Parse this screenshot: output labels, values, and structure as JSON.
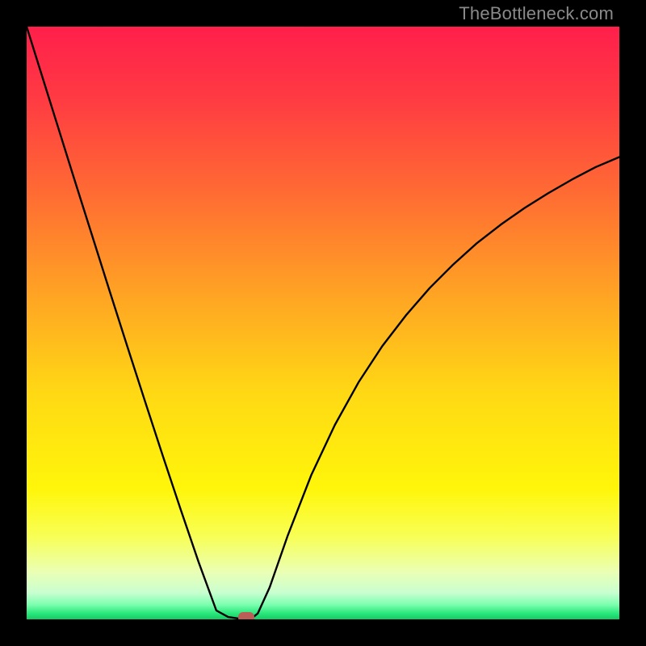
{
  "watermark": {
    "text": "TheBottleneck.com"
  },
  "colors": {
    "frame": "#000000",
    "curve": "#000000",
    "marker": "#bb5e57",
    "gradient_stops": [
      {
        "pct": 0.0,
        "color": "#ff1f4b"
      },
      {
        "pct": 0.12,
        "color": "#ff3a43"
      },
      {
        "pct": 0.28,
        "color": "#ff6b33"
      },
      {
        "pct": 0.45,
        "color": "#ffa324"
      },
      {
        "pct": 0.62,
        "color": "#ffd914"
      },
      {
        "pct": 0.78,
        "color": "#fff60a"
      },
      {
        "pct": 0.86,
        "color": "#f8ff55"
      },
      {
        "pct": 0.92,
        "color": "#eaffb4"
      },
      {
        "pct": 0.955,
        "color": "#c9ffd0"
      },
      {
        "pct": 0.975,
        "color": "#7dffb0"
      },
      {
        "pct": 0.99,
        "color": "#28e87a"
      },
      {
        "pct": 1.0,
        "color": "#17c964"
      }
    ]
  },
  "chart_data": {
    "type": "line",
    "title": "",
    "xlabel": "",
    "ylabel": "",
    "xlim": [
      0,
      100
    ],
    "ylim": [
      0,
      100
    ],
    "series": [
      {
        "name": "bottleneck-curve",
        "x": [
          0,
          2,
          5,
          8,
          11,
          14,
          17,
          20,
          23,
          26,
          29,
          32,
          34,
          36,
          37,
          38,
          39,
          41,
          44,
          48,
          52,
          56,
          60,
          64,
          68,
          72,
          76,
          80,
          84,
          88,
          92,
          96,
          100
        ],
        "y": [
          100,
          93.6,
          84.0,
          74.4,
          64.9,
          55.4,
          46.0,
          36.7,
          27.5,
          18.5,
          9.7,
          1.5,
          0.4,
          0.1,
          0.0,
          0.2,
          1.0,
          5.4,
          14.0,
          24.3,
          32.8,
          40.0,
          46.1,
          51.3,
          55.9,
          59.9,
          63.5,
          66.6,
          69.4,
          71.9,
          74.2,
          76.3,
          78.0
        ]
      }
    ],
    "marker": {
      "x": 37,
      "y": 0
    }
  }
}
